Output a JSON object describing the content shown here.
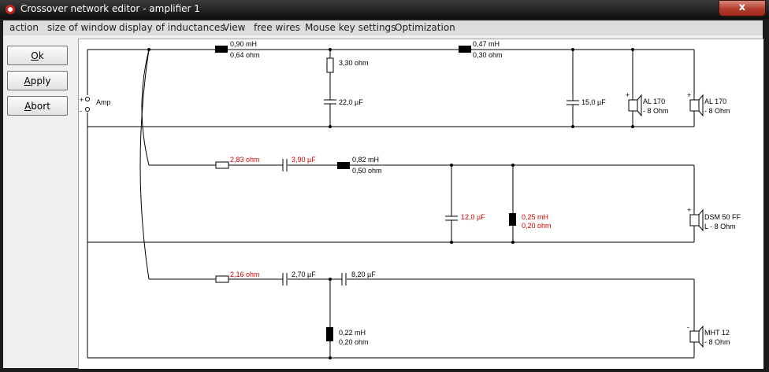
{
  "window": {
    "title": "Crossover network editor - amplifier 1",
    "close_glyph": "x"
  },
  "menu": [
    "action",
    "size of window",
    "display of inductances",
    "View",
    "free wires",
    "Mouse key settings",
    "Optimization"
  ],
  "buttons": {
    "ok": "Ok",
    "apply": "Apply",
    "abort": "Abort"
  },
  "circuit": {
    "source": {
      "plus": "+",
      "minus": "-",
      "label": "Amp"
    },
    "woofer": {
      "l1": {
        "value": "0,90 mH",
        "resistance": "0,64 ohm"
      },
      "r1": "3,30 ohm",
      "c1": "22,0 µF",
      "l2": {
        "value": "0,47 mH",
        "resistance": "0,30 ohm"
      },
      "c2": "15,0 µF",
      "speaker1": {
        "name": "AL 170",
        "impedance": "- 8 Ohm"
      },
      "speaker2": {
        "name": "AL 170",
        "impedance": "- 8 Ohm"
      }
    },
    "mid": {
      "r1": "2,83 ohm",
      "c1": "3,90 µF",
      "l1": {
        "value": "0,82 mH",
        "resistance": "0,50 ohm"
      },
      "c2": "12,0 µF",
      "l2": {
        "value": "0,25 mH",
        "resistance": "0,20 ohm"
      },
      "speaker": {
        "name": "DSM 50 FF",
        "impedance": "L - 8 Ohm"
      }
    },
    "tweeter": {
      "r1": "2,16 ohm",
      "c1": "2,70 µF",
      "c2": "8,20 µF",
      "l1": {
        "value": "0,22 mH",
        "resistance": "0,20 ohm"
      },
      "speaker": {
        "name": "MHT 12",
        "impedance": "- 8 Ohm"
      }
    }
  },
  "colors": {
    "wire": "#000000",
    "optimized_value": "#d40000",
    "label": "#000000"
  }
}
